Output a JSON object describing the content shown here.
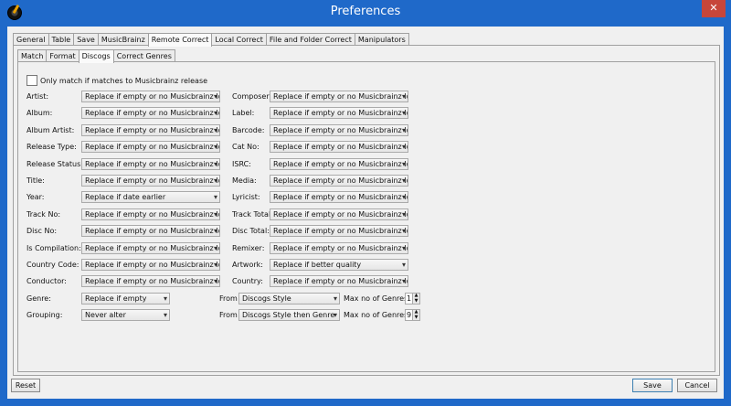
{
  "window": {
    "title": "Preferences",
    "close_glyph": "✕",
    "app_icon": "album-disc-icon"
  },
  "outer_tabs": [
    "General",
    "Table",
    "Save",
    "MusicBrainz",
    "Remote Correct",
    "Local Correct",
    "File and Folder Correct",
    "Manipulators"
  ],
  "inner_tabs": [
    "Match",
    "Format",
    "Discogs",
    "Correct Genres"
  ],
  "only_match_label": "Only match if matches to Musicbrainz release",
  "left_fields": [
    {
      "label": "Artist:",
      "value": "Replace if empty or no Musicbrainz Id"
    },
    {
      "label": "Album:",
      "value": "Replace if empty or no Musicbrainz Id"
    },
    {
      "label": "Album Artist:",
      "value": "Replace if empty or no Musicbrainz Id"
    },
    {
      "label": "Release Type:",
      "value": "Replace if empty or no Musicbrainz Id"
    },
    {
      "label": "Release Status:",
      "value": "Replace if empty or no Musicbrainz Id"
    },
    {
      "label": "Title:",
      "value": "Replace if empty or no Musicbrainz Id"
    },
    {
      "label": "Year:",
      "value": "Replace if date earlier"
    },
    {
      "label": "Track No:",
      "value": "Replace if empty or no Musicbrainz Id"
    },
    {
      "label": "Disc No:",
      "value": "Replace if empty or no Musicbrainz Id"
    },
    {
      "label": "Is Compilation:",
      "value": "Replace if empty or no Musicbrainz Id"
    },
    {
      "label": "Country Code:",
      "value": "Replace if empty or no Musicbrainz Id"
    },
    {
      "label": "Conductor:",
      "value": "Replace if empty or no Musicbrainz Id"
    }
  ],
  "right_fields": [
    {
      "label": "Composer:",
      "value": "Replace if empty or no Musicbrainz Id"
    },
    {
      "label": "Label:",
      "value": "Replace if empty or no Musicbrainz Id"
    },
    {
      "label": "Barcode:",
      "value": "Replace if empty or no Musicbrainz Id"
    },
    {
      "label": "Cat No:",
      "value": "Replace if empty or no Musicbrainz Id"
    },
    {
      "label": "ISRC:",
      "value": "Replace if empty or no Musicbrainz Id"
    },
    {
      "label": "Media:",
      "value": "Replace if empty or no Musicbrainz Id"
    },
    {
      "label": "Lyricist:",
      "value": "Replace if empty or no Musicbrainz Id"
    },
    {
      "label": "Track Total:",
      "value": "Replace if empty or no Musicbrainz Id"
    },
    {
      "label": "Disc Total:",
      "value": "Replace if empty or no Musicbrainz Id"
    },
    {
      "label": "Remixer:",
      "value": "Replace if empty or no Musicbrainz Id"
    },
    {
      "label": "Artwork:",
      "value": "Replace if better quality"
    },
    {
      "label": "Country:",
      "value": "Replace if empty or no Musicbrainz Id"
    }
  ],
  "genre": {
    "label": "Genre:",
    "value": "Replace if empty",
    "from_label": "From",
    "from_value": "Discogs Style",
    "max_label": "Max no of Genres",
    "max_value": "1"
  },
  "grouping": {
    "label": "Grouping:",
    "value": "Never alter",
    "from_label": "From",
    "from_value": "Discogs Style then Genre",
    "max_label": "Max no of Genres",
    "max_value": "9"
  },
  "buttons": {
    "reset": "Reset",
    "save": "Save",
    "cancel": "Cancel"
  },
  "glyphs": {
    "dropdown": "▾",
    "spin_up": "▲",
    "spin_down": "▼"
  }
}
